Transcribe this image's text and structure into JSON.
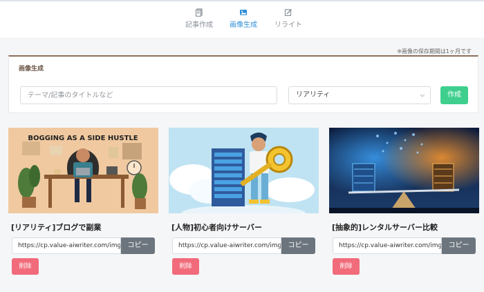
{
  "nav": {
    "tabs": [
      {
        "label": "記事作成",
        "icon": "document-icon",
        "active": false
      },
      {
        "label": "画像生成",
        "icon": "image-icon",
        "active": true
      },
      {
        "label": "リライト",
        "icon": "rewrite-icon",
        "active": false
      }
    ]
  },
  "retention_note": "※画像の保存期間は1ヶ月です",
  "form": {
    "title": "画像生成",
    "topic_placeholder": "テーマ/記事のタイトルなど",
    "topic_value": "",
    "style_selected": "リアリティ",
    "create_label": "作成"
  },
  "cards": [
    {
      "title": "[リアリティ]ブログで副業",
      "url": "https://cp.value-aiwriter.com/img",
      "copy_label": "コピー",
      "delete_label": "削除",
      "image_text": "BOGGING AS A SIDE HUSTLE"
    },
    {
      "title": "[人物]初心者向けサーバー",
      "url": "https://cp.value-aiwriter.com/img",
      "copy_label": "コピー",
      "delete_label": "削除"
    },
    {
      "title": "[抽象的]レンタルサーバー比較",
      "url": "https://cp.value-aiwriter.com/img",
      "copy_label": "コピー",
      "delete_label": "削除"
    }
  ],
  "colors": {
    "accent": "#2f8fd8",
    "create": "#3ecf8e",
    "copy": "#6c757d",
    "delete": "#f16b7a"
  }
}
